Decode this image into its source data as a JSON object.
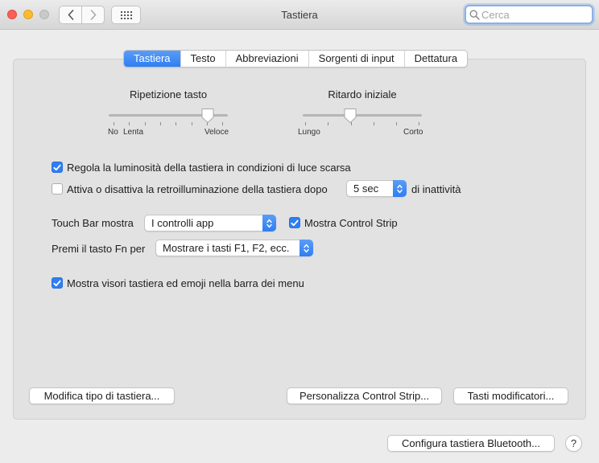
{
  "window": {
    "title": "Tastiera"
  },
  "search": {
    "placeholder": "Cerca"
  },
  "tabs": [
    "Tastiera",
    "Testo",
    "Abbreviazioni",
    "Sorgenti di input",
    "Dettatura"
  ],
  "active_tab": "Tastiera",
  "key_repeat": {
    "title": "Ripetizione tasto",
    "label_no": "No",
    "label_slow": "Lenta",
    "label_fast": "Veloce",
    "value_fraction": 0.83
  },
  "delay_until_repeat": {
    "title": "Ritardo iniziale",
    "label_long": "Lungo",
    "label_short": "Corto",
    "value_fraction": 0.4
  },
  "brightness": {
    "label": "Regola la luminosità della tastiera in condizioni di luce scarsa",
    "checked": true
  },
  "backlight": {
    "label": "Attiva o disattiva la retroilluminazione della tastiera dopo",
    "checked": false,
    "value": "5 sec",
    "suffix": "di inattività"
  },
  "touchbar": {
    "label": "Touch Bar mostra",
    "value": "I controlli app",
    "control_strip_label": "Mostra Control Strip",
    "control_strip_checked": true
  },
  "fn_key": {
    "label": "Premi il tasto Fn per",
    "value": "Mostrare i tasti F1, F2, ecc."
  },
  "menu_viewers": {
    "label": "Mostra visori tastiera ed emoji nella barra dei menu",
    "checked": true
  },
  "buttons": {
    "change_type": "Modifica tipo di tastiera...",
    "customize_strip": "Personalizza Control Strip...",
    "modifier_keys": "Tasti modificatori...",
    "bluetooth": "Configura tastiera Bluetooth...",
    "help": "?"
  },
  "colors": {
    "accent": "#2f7ef2",
    "close": "#fc5f57",
    "minimize": "#fdbc2e",
    "zoom_disabled": "#c9c9c9"
  }
}
